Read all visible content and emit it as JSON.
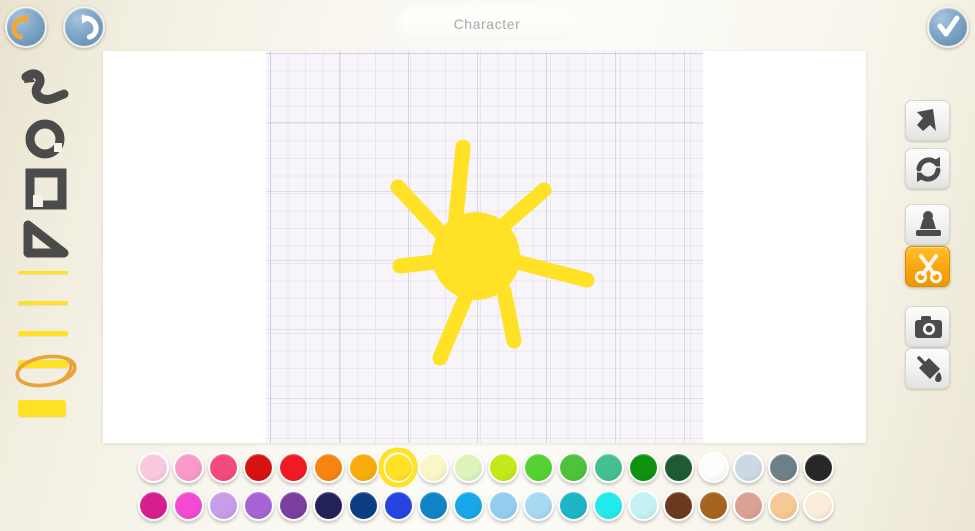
{
  "app": {
    "title_value": "Character",
    "background_color": "#f5f1e4"
  },
  "topbar": {
    "undo_label": "Undo",
    "undo_icon": "undo-arrow-icon",
    "redo_label": "Redo",
    "redo_icon": "redo-arrow-icon",
    "confirm_label": "Done",
    "confirm_icon": "checkmark-icon"
  },
  "left_tools": {
    "shapes": [
      {
        "name": "squiggle",
        "label": "Free line",
        "icon": "squiggle-icon"
      },
      {
        "name": "circle",
        "label": "Circle",
        "icon": "circle-icon"
      },
      {
        "name": "square",
        "label": "Square",
        "icon": "square-icon"
      },
      {
        "name": "triangle",
        "label": "Triangle",
        "icon": "triangle-icon"
      }
    ],
    "widths": [
      {
        "name": "width-1",
        "label": "Extra thin",
        "thickness": 3,
        "selected": false
      },
      {
        "name": "width-2",
        "label": "Thin",
        "thickness": 4,
        "selected": false
      },
      {
        "name": "width-3",
        "label": "Medium",
        "thickness": 5,
        "selected": false
      },
      {
        "name": "width-4",
        "label": "Thick",
        "thickness": 7,
        "selected": true
      },
      {
        "name": "width-5",
        "label": "Extra thick",
        "thickness": 14,
        "selected": false
      }
    ],
    "selected_width": "width-4",
    "stroke_color": "#ffe226",
    "selection_marker_color": "#e8a33a"
  },
  "right_tools": [
    {
      "name": "select",
      "label": "Select",
      "icon": "cursor-arrow-icon",
      "active": false
    },
    {
      "name": "rotate",
      "label": "Rotate",
      "icon": "rotate-arrows-icon",
      "active": false
    },
    {
      "name": "stamp",
      "label": "Stamp",
      "icon": "stamp-icon",
      "active": false
    },
    {
      "name": "cut",
      "label": "Cut",
      "icon": "scissors-icon",
      "active": true
    },
    {
      "name": "camera",
      "label": "Camera",
      "icon": "camera-icon",
      "active": false
    },
    {
      "name": "fill",
      "label": "Paint bucket",
      "icon": "paint-bucket-icon",
      "active": false
    }
  ],
  "palette": {
    "selected_index": 7,
    "selected_color": "#ffe226",
    "selection_marker_color": "#ffe226",
    "row1": [
      "#f9c9e0",
      "#f79ac8",
      "#f24b7e",
      "#d61212",
      "#f01a26",
      "#f58410",
      "#f8ab0d",
      "#ffe226",
      "#faf6c8",
      "#ddf3b9",
      "#c3e91a",
      "#55d134",
      "#4ec23a",
      "#45c190",
      "#0e9210",
      "#1e5b33",
      "#fdfdfd",
      "#cbd9e4",
      "#6d7f87",
      "#27272a"
    ],
    "row2": [
      "#d61e8e",
      "#f24bd1",
      "#c79ce8",
      "#a764d4",
      "#7b3fa0",
      "#22215a",
      "#0c3d84",
      "#2644e0",
      "#1184c6",
      "#16a8e8",
      "#92cdf0",
      "#a8d8f2",
      "#1db5c4",
      "#22eaea",
      "#c4f1f3",
      "#6b3a1e",
      "#a6651f",
      "#dba193",
      "#f6c893",
      "#faecd6"
    ]
  },
  "canvas": {
    "background": "#ffffff",
    "grid_background": "#f7f5fa",
    "drawing_name": "sun-drawing",
    "drawing_color": "#ffe226"
  }
}
